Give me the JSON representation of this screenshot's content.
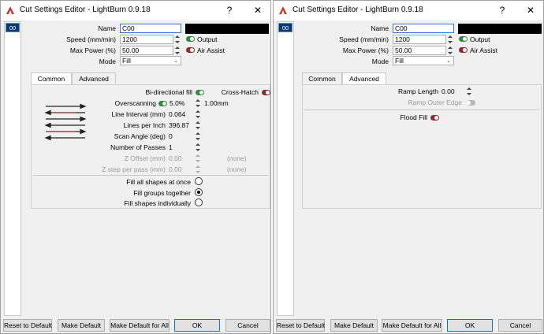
{
  "windows": [
    {
      "title": "Cut Settings Editor - LightBurn 0.9.18",
      "help_btn": "?",
      "close_btn": "✕",
      "layer": "00",
      "name_label": "Name",
      "name_value": "C00",
      "speed_label": "Speed (mm/min)",
      "speed_value": "1200",
      "power_label": "Max Power (%)",
      "power_value": "50.00",
      "mode_label": "Mode",
      "mode_value": "Fill",
      "output_label": "Output",
      "air_label": "Air Assist",
      "tab_common": "Common",
      "tab_advanced": "Advanced",
      "active_tab": "Common",
      "buttons": {
        "reset": "Reset to Default",
        "make_default": "Make Default",
        "make_default_all": "Make Default for All",
        "ok": "OK",
        "cancel": "Cancel"
      }
    },
    {
      "title": "Cut Settings Editor - LightBurn 0.9.18",
      "help_btn": "?",
      "close_btn": "✕",
      "layer": "00",
      "name_label": "Name",
      "name_value": "C00",
      "speed_label": "Speed (mm/min)",
      "speed_value": "1200",
      "power_label": "Max Power (%)",
      "power_value": "50.00",
      "mode_label": "Mode",
      "mode_value": "Fill",
      "output_label": "Output",
      "air_label": "Air Assist",
      "tab_common": "Common",
      "tab_advanced": "Advanced",
      "active_tab": "Advanced",
      "buttons": {
        "reset": "Reset to Default",
        "make_default": "Make Default",
        "make_default_all": "Make Default for All",
        "ok": "OK",
        "cancel": "Cancel"
      }
    }
  ],
  "common": {
    "bidir_label": "Bi-directional fill",
    "crosshatch_label": "Cross-Hatch",
    "overscan_label": "Overscanning",
    "overscan_value": "5.0%",
    "overscan_mm": "1.00mm",
    "interval_label": "Line Interval (mm)",
    "interval_value": "0.064",
    "lpi_label": "Lines per Inch",
    "lpi_value": "396.87",
    "angle_label": "Scan Angle (deg)",
    "angle_value": "0",
    "passes_label": "Number of Passes",
    "passes_value": "1",
    "zoffset_label": "Z Offset (mm)",
    "zoffset_value": "0.00",
    "zoffset_none": "(none)",
    "zstep_label": "Z step per pass (mm)",
    "zstep_value": "0.00",
    "zstep_none": "(none)",
    "fill_all": "Fill all shapes at once",
    "fill_groups": "Fill groups together",
    "fill_individual": "Fill shapes individually",
    "selected_fill": "Fill groups together"
  },
  "advanced": {
    "ramp_label": "Ramp Length",
    "ramp_value": "0.00",
    "ramp_outer_label": "Ramp Outer Edge",
    "flood_label": "Flood Fill"
  },
  "colors": {
    "toggle_on": "#2e8b3a",
    "toggle_off": "#8b2e2e",
    "selected_layer": "#0a3a6e",
    "focus": "#0078d7"
  }
}
